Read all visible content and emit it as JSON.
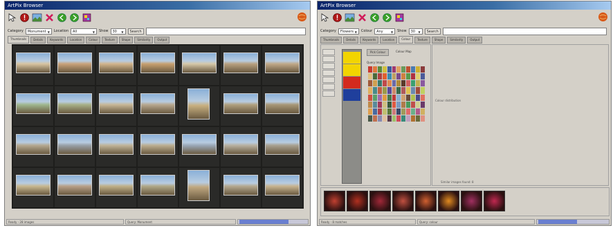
{
  "left_window": {
    "title": "ArtPix Browser",
    "toolbar": [
      {
        "icon": "pointer-icon"
      },
      {
        "icon": "stop-icon"
      },
      {
        "icon": "picture-icon"
      },
      {
        "icon": "delete-icon"
      },
      {
        "icon": "go-back-icon"
      },
      {
        "icon": "go-forward-icon"
      },
      {
        "icon": "palette-icon"
      }
    ],
    "filters": [
      {
        "label": "Category",
        "value": "Monument"
      },
      {
        "label": "Location",
        "value": "All"
      },
      {
        "label": "Show",
        "value": "30"
      }
    ],
    "search_button": "Search",
    "tabs": [
      "Thumbnails",
      "Details",
      "Keywords",
      "Location",
      "Colour",
      "Texture",
      "Shape",
      "Similarity",
      "Output"
    ],
    "status": [
      "Ready - 28 images",
      "Query: Monument",
      "Progress"
    ],
    "progress": 0.72,
    "thumbnails": [
      {
        "c": "#d8c4a0",
        "portrait": false
      },
      {
        "c": "#c9a27a",
        "portrait": false
      },
      {
        "c": "#d2b48c",
        "portrait": false
      },
      {
        "c": "#c8a070",
        "portrait": false
      },
      {
        "c": "#d6c8a8",
        "portrait": false
      },
      {
        "c": "#b8a080",
        "portrait": false
      },
      {
        "c": "#c0a888",
        "portrait": false
      },
      {
        "c": "#a0b890",
        "portrait": false
      },
      {
        "c": "#a8b088",
        "portrait": false
      },
      {
        "c": "#c8b898",
        "portrait": false
      },
      {
        "c": "#b8a890",
        "portrait": false
      },
      {
        "c": "#c8b080",
        "portrait": true
      },
      {
        "c": "#b0a080",
        "portrait": false
      },
      {
        "c": "#a89878",
        "portrait": false
      },
      {
        "c": "#b4a890",
        "portrait": false
      },
      {
        "c": "#98a0a8",
        "portrait": false
      },
      {
        "c": "#c0b498",
        "portrait": false
      },
      {
        "c": "#bcae90",
        "portrait": false
      },
      {
        "c": "#9aa8b8",
        "portrait": false
      },
      {
        "c": "#b8b0a0",
        "portrait": false
      },
      {
        "c": "#a8a090",
        "portrait": false
      },
      {
        "c": "#c8b890",
        "portrait": false
      },
      {
        "c": "#b8a088",
        "portrait": false
      },
      {
        "c": "#c0b088",
        "portrait": false
      },
      {
        "c": "#b0a888",
        "portrait": false
      },
      {
        "c": "#c0a880",
        "portrait": true
      },
      {
        "c": "#b4a890",
        "portrait": false
      },
      {
        "c": "#c8b490",
        "portrait": false
      }
    ]
  },
  "right_window": {
    "title": "ArtPix Browser",
    "filters": [
      {
        "label": "Category",
        "value": "Flowers"
      },
      {
        "label": "Colour",
        "value": "Any"
      },
      {
        "label": "Show",
        "value": "30"
      }
    ],
    "search_button": "Search",
    "tabs": [
      "Thumbnails",
      "Details",
      "Keywords",
      "Location",
      "Colour",
      "Texture",
      "Shape",
      "Similarity",
      "Output"
    ],
    "colour_panel": {
      "button": "Pick Colour",
      "label": "Colour Map",
      "swatches": [
        "#f2d400",
        "#f2d400",
        "#d32a1e",
        "#1f3f9c"
      ],
      "image_title": "Query Image",
      "mosaic": [
        "#c83a30",
        "#e07a40",
        "#5a8a3a",
        "#d0c040",
        "#3a5aa0",
        "#a03a70",
        "#e0a060",
        "#6a9a5a",
        "#c05030",
        "#4a7ab0",
        "#d0b030",
        "#8a3a3a",
        "#e0c080",
        "#4a6a3a",
        "#b04040",
        "#e06030",
        "#3a8ab0",
        "#c0a060",
        "#7a4a8a",
        "#d08040",
        "#5a9a4a",
        "#b03040",
        "#e0d070",
        "#4a5a9a",
        "#a05a3a",
        "#d0a050",
        "#3a7a6a",
        "#c04a4a",
        "#e08a50",
        "#6a6aaa",
        "#b08a3a",
        "#5a3a2a",
        "#d06060",
        "#3aa070",
        "#c0b050",
        "#8a5aa0",
        "#e0b060",
        "#4a8a8a",
        "#c06040",
        "#9a9a4a",
        "#5a4a9a",
        "#d08a6a",
        "#3a6a4a",
        "#b05a5a",
        "#e0c050",
        "#6a8ab0",
        "#a04a3a",
        "#c0d060",
        "#d05040",
        "#5aa06a",
        "#a06ab0",
        "#e09a40",
        "#4a7a4a",
        "#c03a3a",
        "#8ab0d0",
        "#d0a070",
        "#6a4a3a",
        "#b0c050",
        "#4a4a8a",
        "#e07060",
        "#c08a4a",
        "#5a8a9a",
        "#a03a5a",
        "#d0c080",
        "#3a5a3a",
        "#e05a40",
        "#7a9ac0",
        "#b07a4a",
        "#4a9a5a",
        "#c0504a",
        "#d0d090",
        "#6a3a6a",
        "#e0a050",
        "#4a6aa0",
        "#b0404a",
        "#c0c070",
        "#5a7a3a",
        "#d07a7a",
        "#3a4a6a",
        "#a09a5a",
        "#e06a6a",
        "#6ab08a",
        "#b05a8a",
        "#d0b060",
        "#4a5a4a",
        "#c07050",
        "#8a8ab0",
        "#e0c0a0",
        "#5a3a4a",
        "#a0c06a",
        "#d04a5a",
        "#3a8a7a",
        "#c0a0c0",
        "#b07030",
        "#6a6a3a",
        "#e09080"
      ]
    },
    "preview_texts": [
      "Colour distribution",
      "Similar images found: 8"
    ],
    "filmstrip": [
      "#c04030",
      "#b03020",
      "#a02838",
      "#c05040",
      "#d06030",
      "#e08a20",
      "#a03060",
      "#c02850"
    ],
    "status": [
      "Ready - 8 matches",
      "Query: colour",
      "Progress"
    ],
    "progress": 0.55
  }
}
